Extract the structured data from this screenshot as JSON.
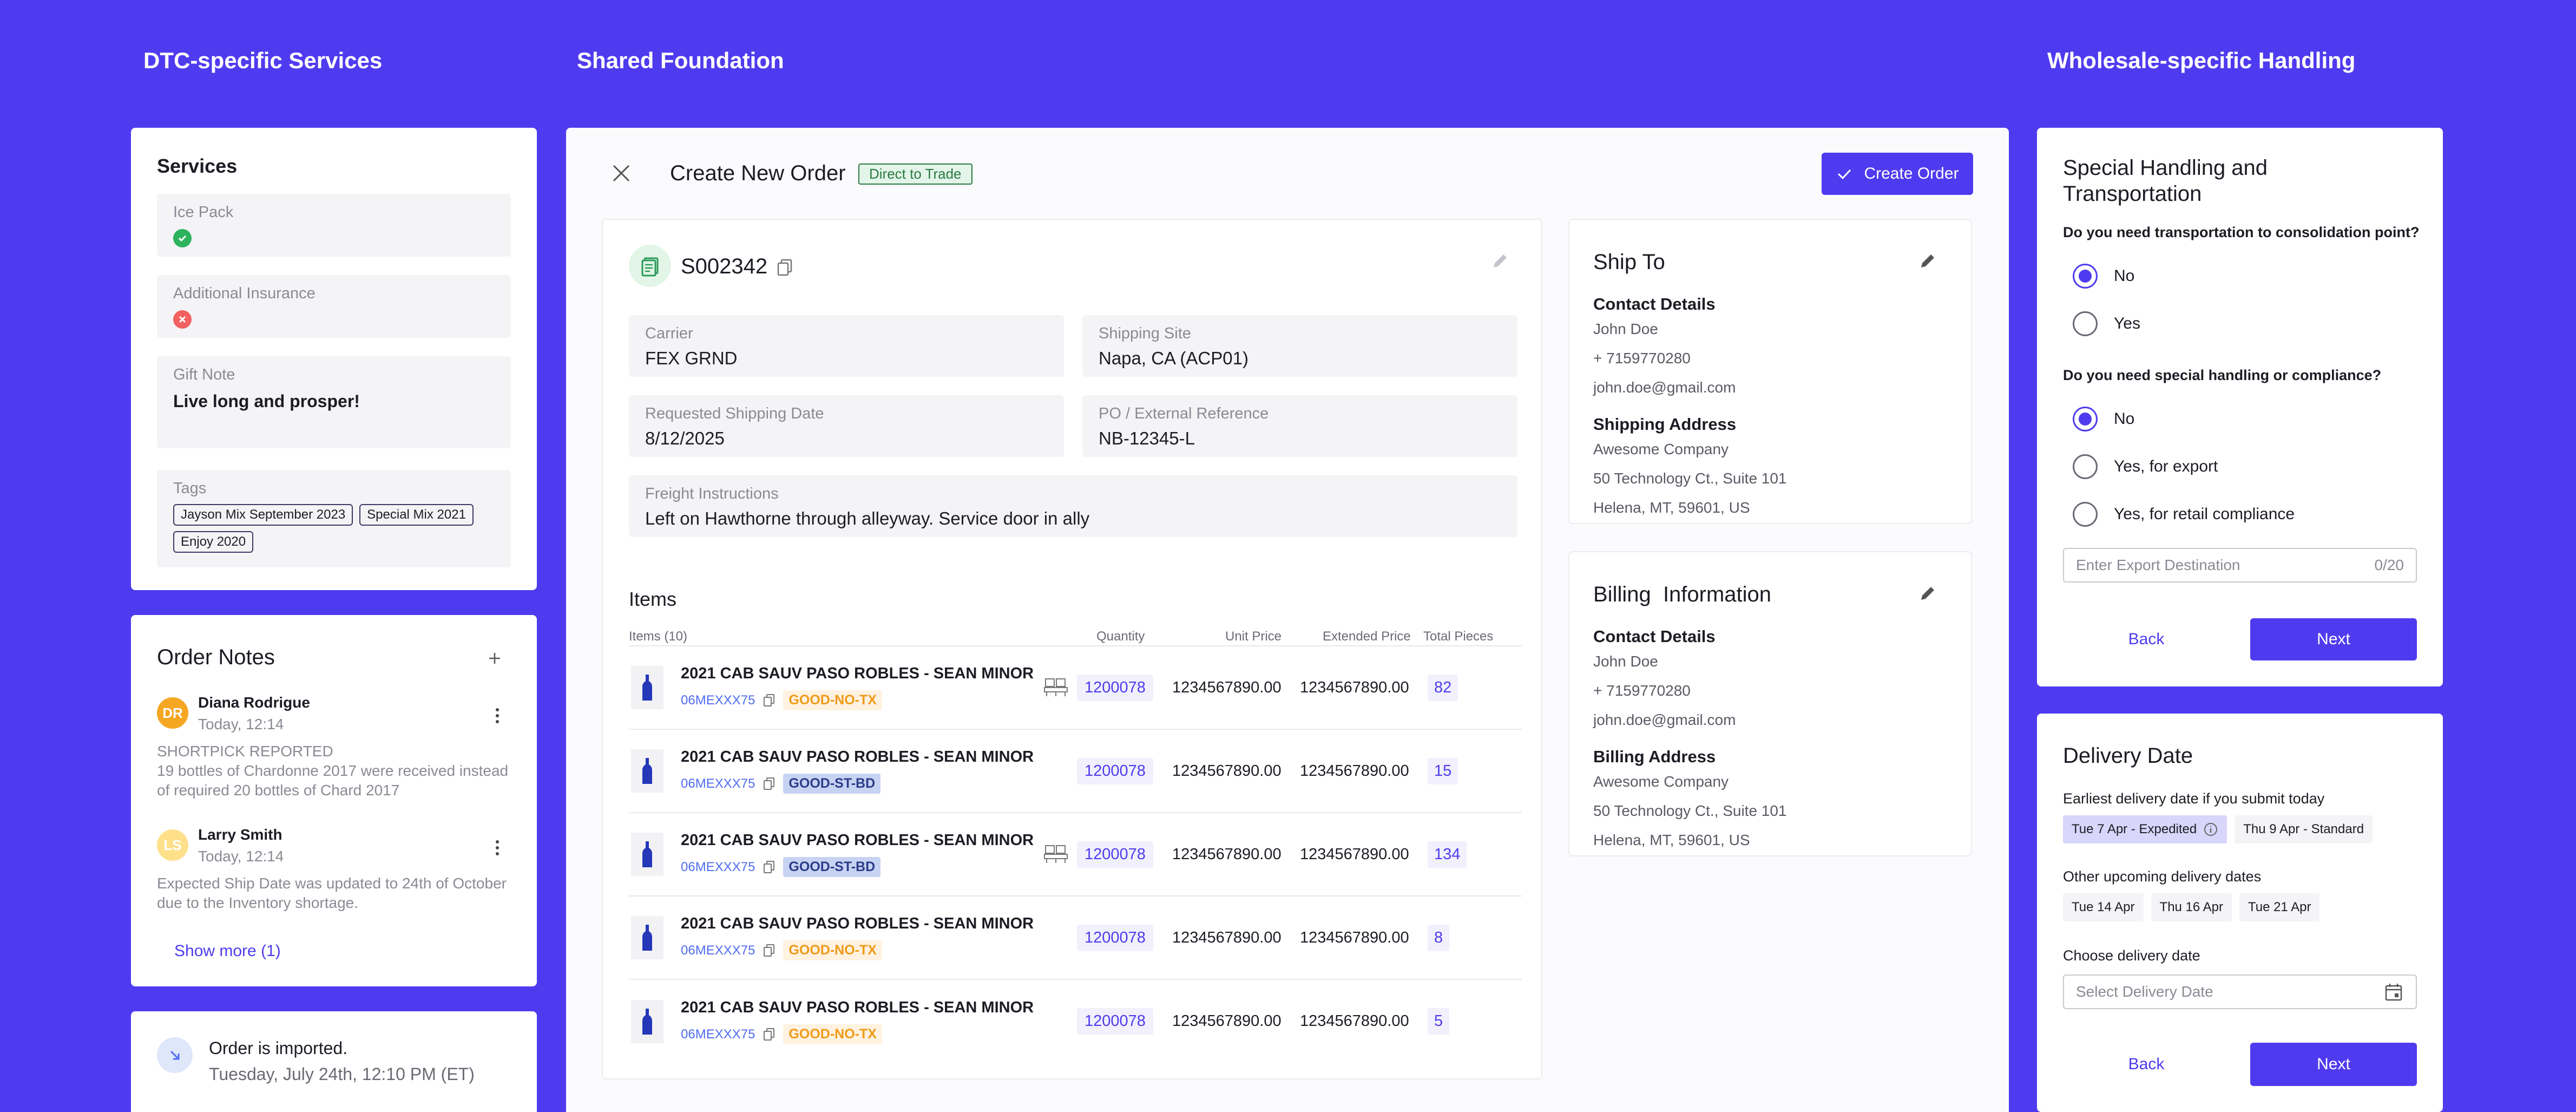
{
  "columns": {
    "dtc": "DTC-specific Services",
    "shared": "Shared Foundation",
    "wholesale": "Wholesale-specific Handling"
  },
  "services": {
    "title": "Services",
    "ice_pack": {
      "label": "Ice Pack",
      "icon": "check-circle-icon",
      "color": "#2db35d"
    },
    "insurance": {
      "label": "Additional Insurance",
      "icon": "x-circle-icon",
      "color": "#f26060"
    },
    "gift_note": {
      "label": "Gift Note",
      "value": "Live long and prosper!"
    },
    "tags": {
      "label": "Tags",
      "items": [
        "Jayson Mix September 2023",
        "Special Mix  2021",
        "Enjoy 2020"
      ]
    }
  },
  "order_notes": {
    "title": "Order Notes",
    "add_icon": "plus-icon",
    "notes": [
      {
        "initials": "DR",
        "avatar_color": "#f5a623",
        "author": "Diana Rodrigue",
        "time": "Today, 12:14",
        "line1": "SHORTPICK REPORTED",
        "line2": "19 bottles of Chardonne 2017 were received instead",
        "line3": "of required 20 bottles of Chard 2017"
      },
      {
        "initials": "LS",
        "avatar_color": "#ffe08a",
        "author": "Larry Smith",
        "time": "Today, 12:14",
        "line1": "Expected Ship Date was updated to 24th of October",
        "line2": "due to the Inventory shortage."
      }
    ],
    "show_more": "Show more (1)"
  },
  "import_status": {
    "title": "Order is imported.",
    "time": "Tuesday, July 24th, 12:10 PM (ET)"
  },
  "order": {
    "header_title": "Create New Order",
    "badge": "Direct to Trade",
    "create_button": "Create Order",
    "number": "S002342",
    "carrier": {
      "label": "Carrier",
      "value": "FEX GRND"
    },
    "shipping_site": {
      "label": "Shipping Site",
      "value": "Napa, CA (ACP01)"
    },
    "requested_date": {
      "label": "Requested Shipping Date",
      "value": "8/12/2025"
    },
    "po_ref": {
      "label": "PO / External Reference",
      "value": "NB-12345-L"
    },
    "freight": {
      "label": "Freight Instructions",
      "value": "Left on Hawthorne through alleyway. Service door in ally"
    },
    "items_title": "Items",
    "columns": {
      "items": "Items (10)",
      "quantity": "Quantity",
      "unit_price": "Unit Price",
      "extended": "Extended Price",
      "pieces": "Total Pieces"
    },
    "items": [
      {
        "name": "2021 CAB SAUV PASO ROBLES - SEAN MINOR",
        "sku": "06MEXXX75",
        "status": "GOOD-NO-TX",
        "status_kind": "orange",
        "pallet": true,
        "quantity": "1200078",
        "unit_price": "1234567890.00",
        "extended": "1234567890.00",
        "pieces": "82"
      },
      {
        "name": "2021 CAB SAUV PASO ROBLES - SEAN MINOR",
        "sku": "06MEXXX75",
        "status": "GOOD-ST-BD",
        "status_kind": "blue",
        "pallet": false,
        "quantity": "1200078",
        "unit_price": "1234567890.00",
        "extended": "1234567890.00",
        "pieces": "15"
      },
      {
        "name": "2021 CAB SAUV PASO ROBLES - SEAN MINOR",
        "sku": "06MEXXX75",
        "status": "GOOD-ST-BD",
        "status_kind": "blue",
        "pallet": true,
        "quantity": "1200078",
        "unit_price": "1234567890.00",
        "extended": "1234567890.00",
        "pieces": "134"
      },
      {
        "name": "2021 CAB SAUV PASO ROBLES - SEAN MINOR",
        "sku": "06MEXXX75",
        "status": "GOOD-NO-TX",
        "status_kind": "orange",
        "pallet": false,
        "quantity": "1200078",
        "unit_price": "1234567890.00",
        "extended": "1234567890.00",
        "pieces": "8"
      },
      {
        "name": "2021 CAB SAUV PASO ROBLES - SEAN MINOR",
        "sku": "06MEXXX75",
        "status": "GOOD-NO-TX",
        "status_kind": "orange",
        "pallet": false,
        "quantity": "1200078",
        "unit_price": "1234567890.00",
        "extended": "1234567890.00",
        "pieces": "5"
      }
    ]
  },
  "ship_to": {
    "title": "Ship To",
    "contact_title": "Contact Details",
    "name": "John Doe",
    "phone": "+ 7159770280",
    "email": "john.doe@gmail.com",
    "address_title": "Shipping Address",
    "company": "Awesome Company",
    "street": "50 Technology Ct., Suite 101",
    "city": "Helena, MT, 59601, US"
  },
  "billing": {
    "title": "Billing  Information",
    "contact_title": "Contact Details",
    "name": "John Doe",
    "phone": "+ 7159770280",
    "email": "john.doe@gmail.com",
    "address_title": "Billing Address",
    "company": "Awesome Company",
    "street": "50 Technology Ct., Suite 101",
    "city": "Helena, MT, 59601, US"
  },
  "handling": {
    "title_line1": "Special Handling and",
    "title_line2": "Transportation",
    "q1": "Do you need transportation to consolidation point?",
    "q1_options": [
      {
        "label": "No",
        "selected": true
      },
      {
        "label": "Yes",
        "selected": false
      }
    ],
    "q2": "Do you need special handling or compliance?",
    "q2_options": [
      {
        "label": "No",
        "selected": true
      },
      {
        "label": "Yes, for export",
        "selected": false
      },
      {
        "label": "Yes, for retail compliance",
        "selected": false
      }
    ],
    "export_placeholder": "Enter Export Destination",
    "counter": "0/20",
    "back": "Back",
    "next": "Next"
  },
  "delivery": {
    "title": "Delivery Date",
    "earliest_label": "Earliest delivery date if you submit today",
    "earliest_options": [
      "Tue 7 Apr - Expedited",
      "Thu 9 Apr - Standard"
    ],
    "other_label": "Other upcoming delivery dates",
    "other_options": [
      "Tue 14 Apr",
      "Thu 16 Apr",
      "Tue 21 Apr"
    ],
    "choose_label": "Choose delivery date",
    "choose_placeholder": "Select Delivery Date",
    "back": "Back",
    "next": "Next"
  },
  "colors": {
    "accent": "#4f3bef",
    "background": "#4f3bef",
    "success": "#2db35d",
    "error": "#f26060",
    "warning": "#f09a19"
  }
}
